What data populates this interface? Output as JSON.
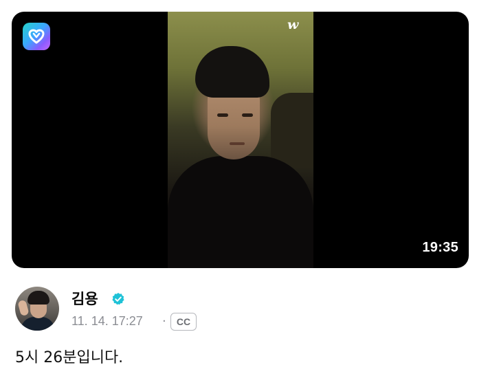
{
  "video": {
    "watermark": "w",
    "duration": "19:35",
    "app_logo_icon": "weverse-heart-icon"
  },
  "post": {
    "author": "김용",
    "verified_icon": "verified-badge-icon",
    "timestamp": "11. 14. 17:27",
    "separator": "·",
    "caption_badge": "CC",
    "body": "5시 26분입니다."
  },
  "colors": {
    "verified": "#1fc2d7",
    "meta_text": "#8b8d93",
    "video_bg": "#000000"
  }
}
